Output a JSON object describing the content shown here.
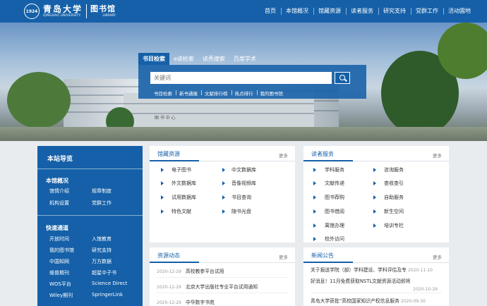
{
  "header": {
    "logo_seal": "1924",
    "university_cn": "青岛大学",
    "university_en": "QINGDAO UNIVERSITY",
    "library_cn": "图书馆",
    "library_en": "LIBRARY",
    "brand_color": "#1560a8",
    "nav": [
      "首页",
      "本馆概况",
      "馆藏资源",
      "读者服务",
      "研究支持",
      "党群工作",
      "活动園地"
    ]
  },
  "banner": {
    "building_sign": "图 书 中 心",
    "search_tabs": [
      "书目检索",
      "e读检索",
      "读秀搜索",
      "百度学术"
    ],
    "search_placeholder": "关键词",
    "search_button_icon": "search-icon",
    "quick_links": [
      "书目检索",
      "新书通报",
      "文献排行榜",
      "热点排行",
      "我的图书馆"
    ]
  },
  "sidebar": {
    "title": "本站导览",
    "sections": [
      {
        "title": "本馆概况",
        "links": [
          "馆情介绍",
          "规章制度",
          "机构设置",
          "党群工作"
        ]
      },
      {
        "title": "快速通道",
        "links": [
          "开放时间",
          "入馆教育",
          "我的图书馆",
          "研究支持",
          "中国知网",
          "万方数据",
          "维普期刊",
          "超星中子书",
          "WOS平台",
          "Science Direct",
          "Wiley期刊",
          "SpringerLink"
        ]
      }
    ]
  },
  "collection": {
    "title": "馆藏资源",
    "more": "更多",
    "items": [
      "电子图书",
      "中文数据库",
      "外文数据库",
      "音像视频库",
      "试用数据库",
      "书目查询",
      "特色文献",
      "随书光盘"
    ]
  },
  "reader_services": {
    "title": "读者服务",
    "more": "更多",
    "items": [
      "学科服务",
      "咨询服务",
      "文献传递",
      "查收查引",
      "图书荐购",
      "自助服务",
      "图书借阅",
      "新生空间",
      "离馆办理",
      "培训专栏",
      "校外访问"
    ]
  },
  "resource_news": {
    "title": "资源动态",
    "more": "更多",
    "items": [
      {
        "date": "2020-12-29",
        "text": "高校教参平台试用"
      },
      {
        "date": "2020-12-29",
        "text": "北京大学出版社专业平台试用通知"
      },
      {
        "date": "2020-12-29",
        "text": "中华数字书苑"
      }
    ]
  },
  "announcements": {
    "title": "新闻公告",
    "more": "更多",
    "items": [
      {
        "text": "关于报送学院（部）学科建设、学科评估及专",
        "date": "2020-11-10"
      },
      {
        "text": "好消息！11月免费获取NSTL文献资源活动即将",
        "date": "2020-10-29"
      },
      {
        "text": "青岛大学获批“高校国家知识产权信息服务",
        "date": "2020-09-30"
      }
    ]
  }
}
